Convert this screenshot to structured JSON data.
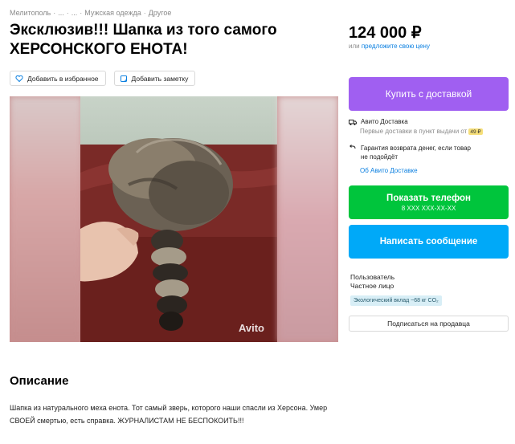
{
  "breadcrumb": [
    "Мелитополь",
    "...",
    "...",
    "Мужская одежда",
    "Другое"
  ],
  "title": "Эксклюзив!!! Шапка из того самого ХЕРСОНСКОГО ЕНОТА!",
  "price": "124 000 ₽",
  "price_note": {
    "prefix": "или",
    "link": "предложите свою цену"
  },
  "actions": {
    "favorite": "Добавить в избранное",
    "note": "Добавить заметку"
  },
  "photo": {
    "watermark": "Avito"
  },
  "buy_button": "Купить с доставкой",
  "delivery": {
    "title": "Авито Доставка",
    "subtitle": "Первые доставки в пункт выдачи от",
    "badge": "49 ₽",
    "guarantee_line1": "Гарантия возврата денег, если товар",
    "guarantee_line2": "не подойдёт",
    "about_link": "Об Авито Доставке"
  },
  "phone_button": {
    "label": "Показать телефон",
    "number": "8 XXX XXX-XX-XX"
  },
  "message_button": "Написать сообщение",
  "seller": {
    "name": "Пользователь",
    "type": "Частное лицо",
    "eco_badge": "Экологический вклад ~68 кг CO₂"
  },
  "subscribe_button": "Подписаться на продавца",
  "description": {
    "title": "Описание",
    "text": "Шапка из натурального меха енота. Тот самый зверь, которого наши спасли из Херсона. Умер СВОЕЙ смертью, есть справка. ЖУРНАЛИСТАМ НЕ БЕСПОКОИТЬ!!!"
  },
  "colors": {
    "buy": "#a05ff1",
    "phone": "#00c53c",
    "message": "#00a9f8",
    "link": "#0a7fe0"
  }
}
